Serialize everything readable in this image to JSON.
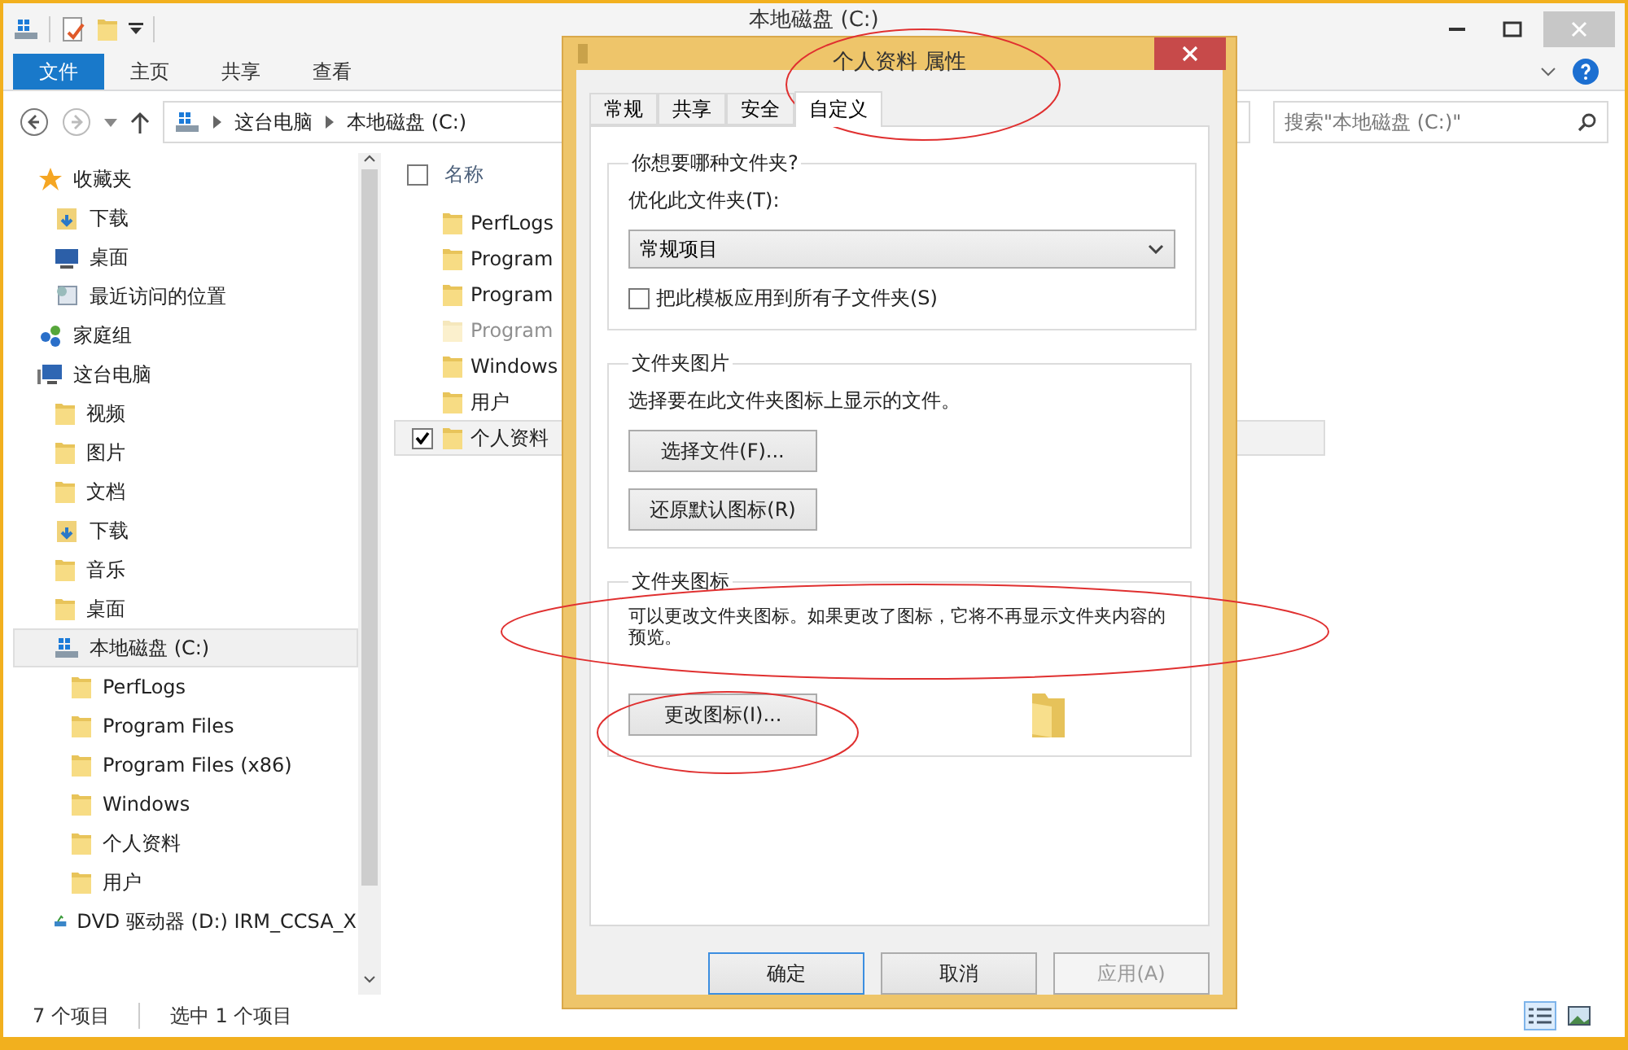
{
  "explorer": {
    "title": "本地磁盘 (C:)",
    "ribbon_tabs": [
      {
        "label": "文件",
        "selected": true
      },
      {
        "label": "主页",
        "selected": false
      },
      {
        "label": "共享",
        "selected": false
      },
      {
        "label": "查看",
        "selected": false
      }
    ],
    "breadcrumb": [
      "这台电脑",
      "本地磁盘 (C:)"
    ],
    "search": {
      "placeholder": "搜索\"本地磁盘 (C:)\""
    },
    "nav": [
      {
        "label": "收藏夹",
        "kind": "star",
        "selected": false,
        "children": [
          {
            "label": "下载",
            "kind": "download",
            "selected": false
          },
          {
            "label": "桌面",
            "kind": "desktop",
            "selected": false
          },
          {
            "label": "最近访问的位置",
            "kind": "recent",
            "selected": false
          }
        ]
      },
      {
        "label": "家庭组",
        "kind": "network",
        "selected": false
      },
      {
        "label": "这台电脑",
        "kind": "computer",
        "selected": false,
        "children": [
          {
            "label": "视频",
            "kind": "folder",
            "selected": false
          },
          {
            "label": "图片",
            "kind": "folder",
            "selected": false
          },
          {
            "label": "文档",
            "kind": "folder",
            "selected": false
          },
          {
            "label": "下载",
            "kind": "download",
            "selected": false
          },
          {
            "label": "音乐",
            "kind": "folder",
            "selected": false
          },
          {
            "label": "桌面",
            "kind": "folder",
            "selected": false
          },
          {
            "label": "本地磁盘 (C:)",
            "kind": "drive",
            "selected": true,
            "children": [
              {
                "label": "PerfLogs",
                "kind": "folder",
                "selected": false
              },
              {
                "label": "Program Files",
                "kind": "folder",
                "selected": false
              },
              {
                "label": "Program Files (x86)",
                "kind": "folder",
                "selected": false
              },
              {
                "label": "Windows",
                "kind": "folder",
                "selected": false
              },
              {
                "label": "个人资料",
                "kind": "folder",
                "selected": false
              },
              {
                "label": "用户",
                "kind": "folder",
                "selected": false
              }
            ]
          },
          {
            "label": "DVD 驱动器 (D:) IRM_CCSA_X",
            "kind": "disc",
            "selected": false
          }
        ]
      }
    ],
    "file_list": {
      "header": "名称",
      "select_all_checked": false,
      "rows": [
        {
          "name": "PerfLogs",
          "hidden": false,
          "checked": false,
          "selected": false
        },
        {
          "name": "Program",
          "hidden": false,
          "checked": false,
          "selected": false
        },
        {
          "name": "Program",
          "hidden": false,
          "checked": false,
          "selected": false
        },
        {
          "name": "Program",
          "hidden": true,
          "checked": false,
          "selected": false
        },
        {
          "name": "Windows",
          "hidden": false,
          "checked": false,
          "selected": false
        },
        {
          "name": "用户",
          "hidden": false,
          "checked": false,
          "selected": false
        },
        {
          "name": "个人资料",
          "hidden": false,
          "checked": true,
          "selected": true
        }
      ]
    },
    "status_bar": {
      "count": "7 个项目",
      "selection": "选中 1 个项目"
    },
    "view_buttons": [
      {
        "kind": "details",
        "selected": true
      },
      {
        "kind": "thumbnails",
        "selected": false
      }
    ]
  },
  "dialog": {
    "title": "个人资料 属性",
    "tabs": [
      {
        "label": "常规",
        "selected": false
      },
      {
        "label": "共享",
        "selected": false
      },
      {
        "label": "安全",
        "selected": false
      },
      {
        "label": "自定义",
        "selected": true
      }
    ],
    "folder_type": {
      "heading": "你想要哪种文件夹?",
      "label": "优化此文件夹(T):",
      "select_value": "常规项目",
      "checkbox": {
        "label": "把此模板应用到所有子文件夹(S)",
        "checked": false
      }
    },
    "folder_picture": {
      "heading": "文件夹图片",
      "description": "选择要在此文件夹图标上显示的文件。",
      "buttons": [
        "选择文件(F)...",
        "还原默认图标(R)"
      ]
    },
    "folder_icon": {
      "heading": "文件夹图标",
      "description": "可以更改文件夹图标。如果更改了图标，它将不再显示文件夹内容的预览。",
      "button": "更改图标(I)..."
    },
    "buttons": [
      {
        "label": "确定",
        "default": true,
        "disabled": false
      },
      {
        "label": "取消",
        "default": false,
        "disabled": false
      },
      {
        "label": "应用(A)",
        "default": false,
        "disabled": true
      }
    ]
  }
}
